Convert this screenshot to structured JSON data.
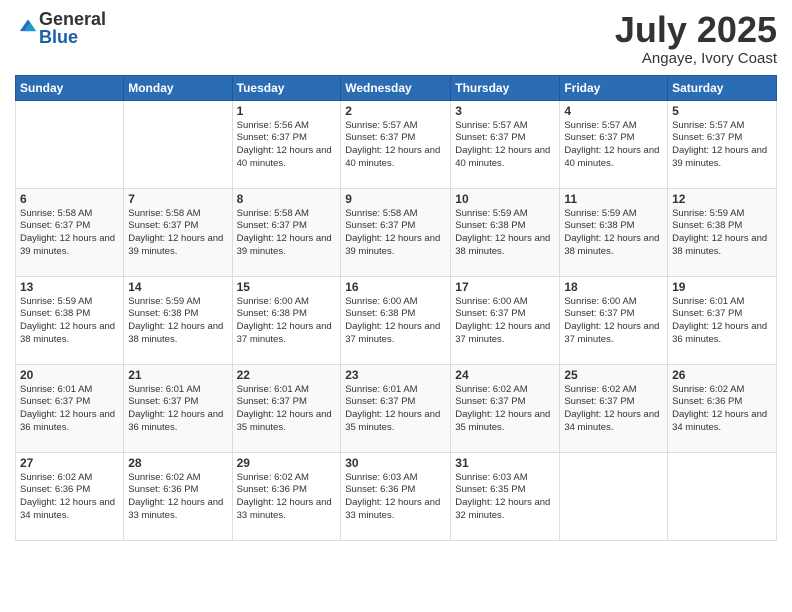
{
  "header": {
    "logo_general": "General",
    "logo_blue": "Blue",
    "month_title": "July 2025",
    "location": "Angaye, Ivory Coast"
  },
  "weekdays": [
    "Sunday",
    "Monday",
    "Tuesday",
    "Wednesday",
    "Thursday",
    "Friday",
    "Saturday"
  ],
  "weeks": [
    [
      {
        "day": "",
        "sunrise": "",
        "sunset": "",
        "daylight": ""
      },
      {
        "day": "",
        "sunrise": "",
        "sunset": "",
        "daylight": ""
      },
      {
        "day": "1",
        "sunrise": "Sunrise: 5:56 AM",
        "sunset": "Sunset: 6:37 PM",
        "daylight": "Daylight: 12 hours and 40 minutes."
      },
      {
        "day": "2",
        "sunrise": "Sunrise: 5:57 AM",
        "sunset": "Sunset: 6:37 PM",
        "daylight": "Daylight: 12 hours and 40 minutes."
      },
      {
        "day": "3",
        "sunrise": "Sunrise: 5:57 AM",
        "sunset": "Sunset: 6:37 PM",
        "daylight": "Daylight: 12 hours and 40 minutes."
      },
      {
        "day": "4",
        "sunrise": "Sunrise: 5:57 AM",
        "sunset": "Sunset: 6:37 PM",
        "daylight": "Daylight: 12 hours and 40 minutes."
      },
      {
        "day": "5",
        "sunrise": "Sunrise: 5:57 AM",
        "sunset": "Sunset: 6:37 PM",
        "daylight": "Daylight: 12 hours and 39 minutes."
      }
    ],
    [
      {
        "day": "6",
        "sunrise": "Sunrise: 5:58 AM",
        "sunset": "Sunset: 6:37 PM",
        "daylight": "Daylight: 12 hours and 39 minutes."
      },
      {
        "day": "7",
        "sunrise": "Sunrise: 5:58 AM",
        "sunset": "Sunset: 6:37 PM",
        "daylight": "Daylight: 12 hours and 39 minutes."
      },
      {
        "day": "8",
        "sunrise": "Sunrise: 5:58 AM",
        "sunset": "Sunset: 6:37 PM",
        "daylight": "Daylight: 12 hours and 39 minutes."
      },
      {
        "day": "9",
        "sunrise": "Sunrise: 5:58 AM",
        "sunset": "Sunset: 6:37 PM",
        "daylight": "Daylight: 12 hours and 39 minutes."
      },
      {
        "day": "10",
        "sunrise": "Sunrise: 5:59 AM",
        "sunset": "Sunset: 6:38 PM",
        "daylight": "Daylight: 12 hours and 38 minutes."
      },
      {
        "day": "11",
        "sunrise": "Sunrise: 5:59 AM",
        "sunset": "Sunset: 6:38 PM",
        "daylight": "Daylight: 12 hours and 38 minutes."
      },
      {
        "day": "12",
        "sunrise": "Sunrise: 5:59 AM",
        "sunset": "Sunset: 6:38 PM",
        "daylight": "Daylight: 12 hours and 38 minutes."
      }
    ],
    [
      {
        "day": "13",
        "sunrise": "Sunrise: 5:59 AM",
        "sunset": "Sunset: 6:38 PM",
        "daylight": "Daylight: 12 hours and 38 minutes."
      },
      {
        "day": "14",
        "sunrise": "Sunrise: 5:59 AM",
        "sunset": "Sunset: 6:38 PM",
        "daylight": "Daylight: 12 hours and 38 minutes."
      },
      {
        "day": "15",
        "sunrise": "Sunrise: 6:00 AM",
        "sunset": "Sunset: 6:38 PM",
        "daylight": "Daylight: 12 hours and 37 minutes."
      },
      {
        "day": "16",
        "sunrise": "Sunrise: 6:00 AM",
        "sunset": "Sunset: 6:38 PM",
        "daylight": "Daylight: 12 hours and 37 minutes."
      },
      {
        "day": "17",
        "sunrise": "Sunrise: 6:00 AM",
        "sunset": "Sunset: 6:37 PM",
        "daylight": "Daylight: 12 hours and 37 minutes."
      },
      {
        "day": "18",
        "sunrise": "Sunrise: 6:00 AM",
        "sunset": "Sunset: 6:37 PM",
        "daylight": "Daylight: 12 hours and 37 minutes."
      },
      {
        "day": "19",
        "sunrise": "Sunrise: 6:01 AM",
        "sunset": "Sunset: 6:37 PM",
        "daylight": "Daylight: 12 hours and 36 minutes."
      }
    ],
    [
      {
        "day": "20",
        "sunrise": "Sunrise: 6:01 AM",
        "sunset": "Sunset: 6:37 PM",
        "daylight": "Daylight: 12 hours and 36 minutes."
      },
      {
        "day": "21",
        "sunrise": "Sunrise: 6:01 AM",
        "sunset": "Sunset: 6:37 PM",
        "daylight": "Daylight: 12 hours and 36 minutes."
      },
      {
        "day": "22",
        "sunrise": "Sunrise: 6:01 AM",
        "sunset": "Sunset: 6:37 PM",
        "daylight": "Daylight: 12 hours and 35 minutes."
      },
      {
        "day": "23",
        "sunrise": "Sunrise: 6:01 AM",
        "sunset": "Sunset: 6:37 PM",
        "daylight": "Daylight: 12 hours and 35 minutes."
      },
      {
        "day": "24",
        "sunrise": "Sunrise: 6:02 AM",
        "sunset": "Sunset: 6:37 PM",
        "daylight": "Daylight: 12 hours and 35 minutes."
      },
      {
        "day": "25",
        "sunrise": "Sunrise: 6:02 AM",
        "sunset": "Sunset: 6:37 PM",
        "daylight": "Daylight: 12 hours and 34 minutes."
      },
      {
        "day": "26",
        "sunrise": "Sunrise: 6:02 AM",
        "sunset": "Sunset: 6:36 PM",
        "daylight": "Daylight: 12 hours and 34 minutes."
      }
    ],
    [
      {
        "day": "27",
        "sunrise": "Sunrise: 6:02 AM",
        "sunset": "Sunset: 6:36 PM",
        "daylight": "Daylight: 12 hours and 34 minutes."
      },
      {
        "day": "28",
        "sunrise": "Sunrise: 6:02 AM",
        "sunset": "Sunset: 6:36 PM",
        "daylight": "Daylight: 12 hours and 33 minutes."
      },
      {
        "day": "29",
        "sunrise": "Sunrise: 6:02 AM",
        "sunset": "Sunset: 6:36 PM",
        "daylight": "Daylight: 12 hours and 33 minutes."
      },
      {
        "day": "30",
        "sunrise": "Sunrise: 6:03 AM",
        "sunset": "Sunset: 6:36 PM",
        "daylight": "Daylight: 12 hours and 33 minutes."
      },
      {
        "day": "31",
        "sunrise": "Sunrise: 6:03 AM",
        "sunset": "Sunset: 6:35 PM",
        "daylight": "Daylight: 12 hours and 32 minutes."
      },
      {
        "day": "",
        "sunrise": "",
        "sunset": "",
        "daylight": ""
      },
      {
        "day": "",
        "sunrise": "",
        "sunset": "",
        "daylight": ""
      }
    ]
  ]
}
